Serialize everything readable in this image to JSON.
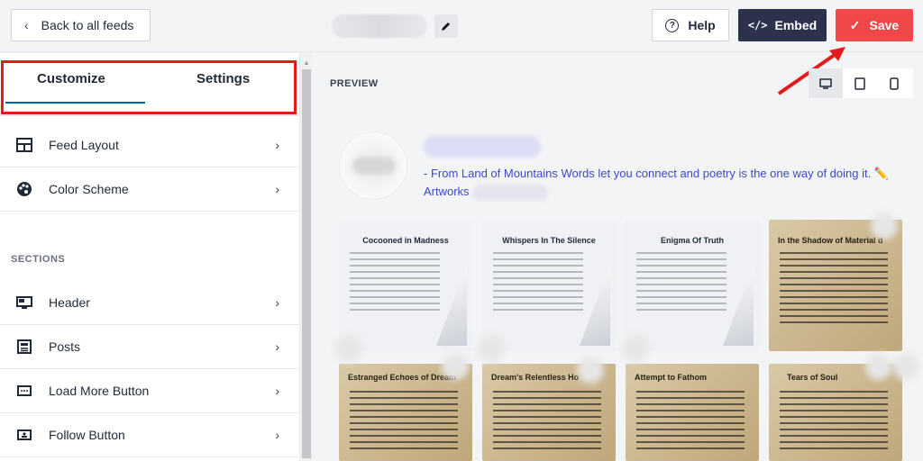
{
  "header": {
    "back_label": "Back to all feeds",
    "help_label": "Help",
    "embed_label": "Embed",
    "save_label": "Save"
  },
  "sidebar": {
    "tabs": [
      {
        "label": "Customize",
        "active": true
      },
      {
        "label": "Settings",
        "active": false
      }
    ],
    "top_items": [
      {
        "label": "Feed Layout",
        "icon": "grid-layout-icon"
      },
      {
        "label": "Color Scheme",
        "icon": "palette-icon"
      }
    ],
    "sections_label": "SECTIONS",
    "section_items": [
      {
        "label": "Header",
        "icon": "header-icon"
      },
      {
        "label": "Posts",
        "icon": "posts-icon"
      },
      {
        "label": "Load More Button",
        "icon": "load-more-icon"
      },
      {
        "label": "Follow Button",
        "icon": "follow-icon"
      }
    ]
  },
  "preview": {
    "label": "PREVIEW",
    "devices": [
      "desktop-icon",
      "tablet-icon",
      "mobile-icon"
    ],
    "active_device": "desktop",
    "bio_text": "- From Land of Mountains Words let you connect and poetry is the one way of doing it. ✏️",
    "bio_text_2": "Artworks",
    "posts": [
      {
        "title": "Cocooned in Madness",
        "style": "light"
      },
      {
        "title": "Whispers In The Silence",
        "style": "light"
      },
      {
        "title": "Enigma Of Truth",
        "style": "light"
      },
      {
        "title": "In the Shadow of Material d",
        "style": "paper"
      },
      {
        "title": "Estranged Echoes of Dream",
        "style": "paper"
      },
      {
        "title": "Dream's Relentless Ho",
        "style": "paper"
      },
      {
        "title": "Attempt to Fathom",
        "style": "paper"
      },
      {
        "title": "Tears of Soul",
        "style": "paper"
      }
    ]
  },
  "colors": {
    "save": "#f04848",
    "embed": "#2c324c",
    "highlight": "#e31b1b",
    "link": "#3b49c4"
  }
}
